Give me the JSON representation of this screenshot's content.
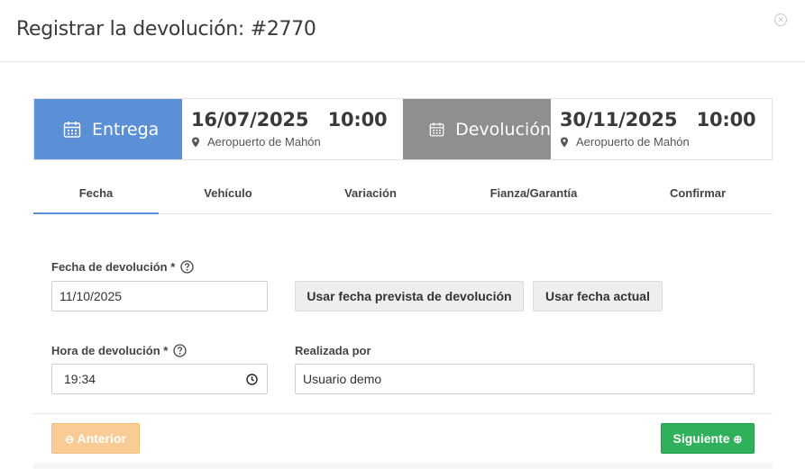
{
  "modal": {
    "title": "Registrar la devolución: #2770",
    "close_icon": "close-circle-icon"
  },
  "summary": {
    "delivery": {
      "label": "Entrega",
      "datetime": "16/07/2025   10:00",
      "place": "Aeropuerto de Mahón",
      "color": "#5b8fd6"
    },
    "return": {
      "label": "Devolución",
      "datetime": "30/11/2025   10:00",
      "place": "Aeropuerto de Mahón",
      "color": "#8f8f8f"
    }
  },
  "tabs": [
    {
      "label": "Fecha",
      "active": true
    },
    {
      "label": "Vehículo"
    },
    {
      "label": "Variación"
    },
    {
      "label": "Fianza/Garantía"
    },
    {
      "label": "Confirmar"
    }
  ],
  "form": {
    "return_date_label": "Fecha de devolución *",
    "return_date_value": "11/10/2025",
    "use_planned_date_label": "Usar fecha prevista de devolución",
    "use_current_date_label": "Usar fecha actual",
    "return_time_label": "Hora de devolución *",
    "return_time_value": "19:34",
    "done_by_label": "Realizada por",
    "done_by_value": "Usuario demo"
  },
  "footer": {
    "prev_label": "Anterior",
    "next_label": "Siguiente",
    "prev_color": "#f8cc94",
    "next_color": "#2fb05a"
  }
}
